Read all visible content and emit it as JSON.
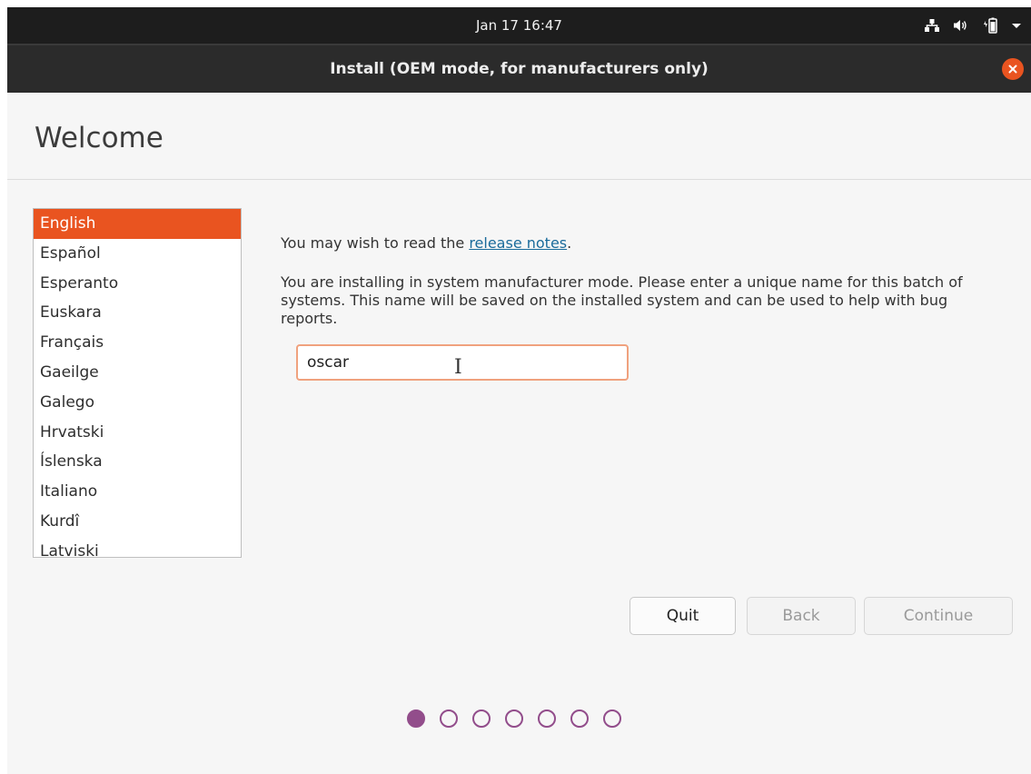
{
  "topbar": {
    "clock": "Jan 17  16:47",
    "icons": [
      "network-icon",
      "volume-icon",
      "battery-icon",
      "system-menu-chevron-icon"
    ]
  },
  "window": {
    "title": "Install (OEM mode, for manufacturers only)",
    "close_color": "#e95420"
  },
  "page": {
    "title": "Welcome"
  },
  "languages": {
    "selected": "English",
    "items": [
      "English",
      "Español",
      "Esperanto",
      "Euskara",
      "Français",
      "Gaeilge",
      "Galego",
      "Hrvatski",
      "Íslenska",
      "Italiano",
      "Kurdî",
      "Latviski"
    ]
  },
  "content": {
    "release_prefix": "You may wish to read the ",
    "release_link": "release notes",
    "release_suffix": ".",
    "oem_description": "You are installing in system manufacturer mode. Please enter a unique name for this batch of systems. This name will be saved on the installed system and can be used to help with bug reports.",
    "batch_name_value": "oscar"
  },
  "buttons": {
    "quit": "Quit",
    "back": "Back",
    "continue": "Continue"
  },
  "progress": {
    "total_steps": 7,
    "current_step": 1
  },
  "colors": {
    "accent": "#e95420",
    "progress": "#924d8b",
    "link": "#1a6b9b"
  }
}
